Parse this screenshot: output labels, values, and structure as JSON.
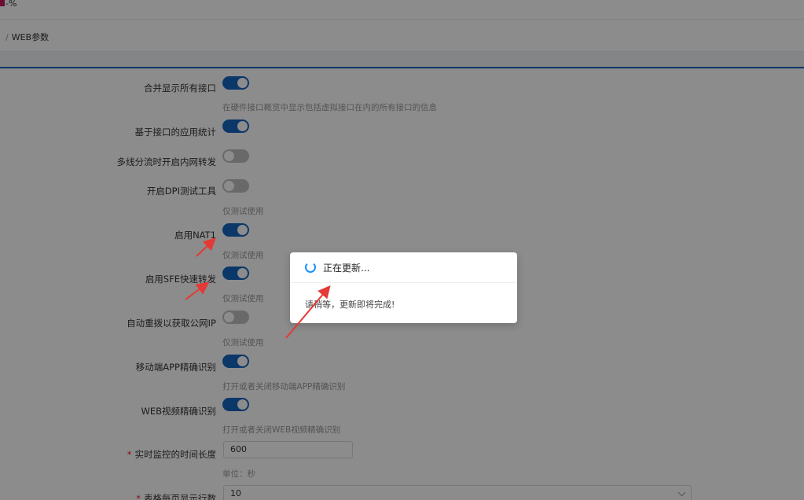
{
  "header": {
    "logo_text": "-%",
    "breadcrumb_sep": "/",
    "breadcrumb": "WEB参数"
  },
  "form": {
    "merge_all_interfaces": {
      "label": "合并显示所有接口",
      "enabled": true,
      "help": "在硬件接口概览中显示包括虚拟接口在内的所有接口的信息"
    },
    "app_stats_by_interface": {
      "label": "基于接口的应用统计",
      "enabled": true
    },
    "multiline_intranet_forward": {
      "label": "多线分流时开启内网转发",
      "enabled": false
    },
    "dpi_test_tool": {
      "label": "开启DPI测试工具",
      "enabled": false,
      "help": "仅测试使用"
    },
    "nat1": {
      "label": "启用NAT1",
      "enabled": true,
      "help": "仅测试使用"
    },
    "sfe_fast_forward": {
      "label": "启用SFE快速转发",
      "enabled": true,
      "help": "仅测试使用"
    },
    "auto_redial_public_ip": {
      "label": "自动重拨以获取公网IP",
      "enabled": false,
      "help": "仅测试使用"
    },
    "mobile_app_precise": {
      "label": "移动端APP精确识别",
      "enabled": true,
      "help": "打开或者关闭移动端APP精确识别"
    },
    "web_video_precise": {
      "label": "WEB视频精确识别",
      "enabled": true,
      "help": "打开或者关闭WEB视频精确识别"
    },
    "monitor_duration": {
      "label": "实时监控的时间长度",
      "value": "600",
      "help": "单位：秒"
    },
    "rows_per_page": {
      "label": "表格每页显示行数",
      "value": "10"
    }
  },
  "modal": {
    "title": "正在更新...",
    "body": "请稍等，更新即将完成!"
  },
  "colors": {
    "accent": "#1565c0",
    "toggle_off": "#bfbfbf",
    "required": "#f5222d",
    "annotation_arrow": "#e53935"
  }
}
